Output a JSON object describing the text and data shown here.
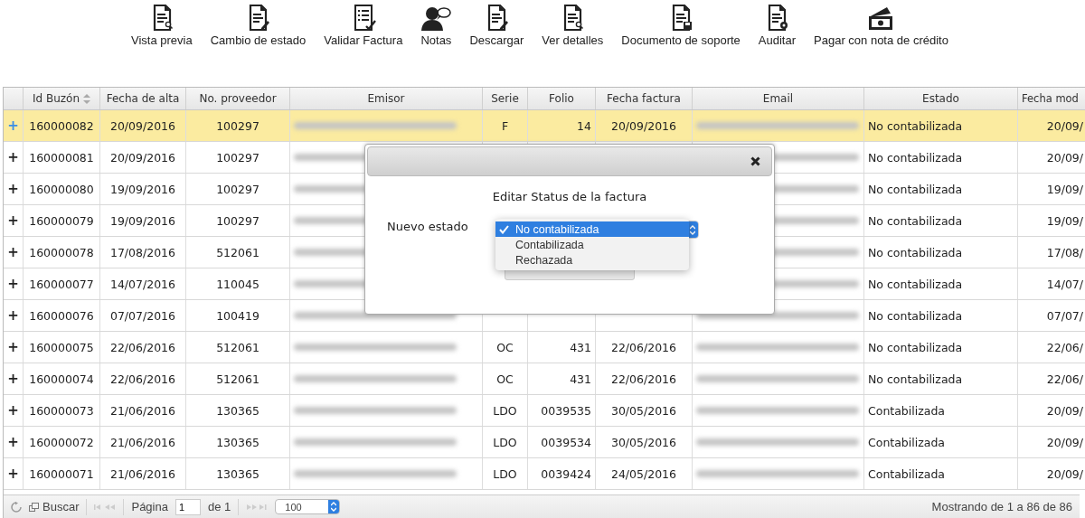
{
  "toolbar": [
    {
      "label": "Vista previa"
    },
    {
      "label": "Cambio de estado"
    },
    {
      "label": "Validar Factura"
    },
    {
      "label": "Notas"
    },
    {
      "label": "Descargar"
    },
    {
      "label": "Ver detalles"
    },
    {
      "label": "Documento de soporte"
    },
    {
      "label": "Auditar"
    },
    {
      "label": "Pagar con nota de crédito"
    }
  ],
  "table": {
    "columns": [
      "Id Buzón",
      "Fecha de alta",
      "No. proveedor",
      "Emisor",
      "Serie",
      "Folio",
      "Fecha factura",
      "Email",
      "Estado",
      "Fecha mod"
    ],
    "rows": [
      {
        "selected": true,
        "expand": "+",
        "cells": [
          "160000082",
          "20/09/2016",
          "100297",
          "",
          "F",
          "14",
          "20/09/2016",
          "",
          "No contabilizada",
          "20/09/"
        ]
      },
      {
        "selected": false,
        "expand": "+",
        "cells": [
          "160000081",
          "20/09/2016",
          "100297",
          "",
          "",
          "",
          "",
          "",
          "No contabilizada",
          "20/09/"
        ]
      },
      {
        "selected": false,
        "expand": "+",
        "cells": [
          "160000080",
          "19/09/2016",
          "100297",
          "",
          "",
          "",
          "",
          "",
          "No contabilizada",
          "19/09/"
        ]
      },
      {
        "selected": false,
        "expand": "+",
        "cells": [
          "160000079",
          "19/09/2016",
          "100297",
          "",
          "",
          "",
          "",
          "",
          "No contabilizada",
          "19/09/"
        ]
      },
      {
        "selected": false,
        "expand": "+",
        "cells": [
          "160000078",
          "17/08/2016",
          "512061",
          "",
          "",
          "",
          "",
          "",
          "No contabilizada",
          "17/08/"
        ]
      },
      {
        "selected": false,
        "expand": "+",
        "cells": [
          "160000077",
          "14/07/2016",
          "110045",
          "",
          "",
          "",
          "",
          "",
          "No contabilizada",
          "14/07/"
        ]
      },
      {
        "selected": false,
        "expand": "+",
        "cells": [
          "160000076",
          "07/07/2016",
          "100419",
          "",
          "",
          "",
          "",
          "",
          "No contabilizada",
          "07/07/"
        ]
      },
      {
        "selected": false,
        "expand": "+",
        "cells": [
          "160000075",
          "22/06/2016",
          "512061",
          "",
          "OC",
          "431",
          "22/06/2016",
          "",
          "No contabilizada",
          "22/06/"
        ]
      },
      {
        "selected": false,
        "expand": "+",
        "cells": [
          "160000074",
          "22/06/2016",
          "512061",
          "",
          "OC",
          "431",
          "22/06/2016",
          "",
          "No contabilizada",
          "22/06/"
        ]
      },
      {
        "selected": false,
        "expand": "+",
        "cells": [
          "160000073",
          "21/06/2016",
          "130365",
          "",
          "LDO",
          "0039535",
          "30/05/2016",
          "",
          "Contabilizada",
          "20/09/"
        ]
      },
      {
        "selected": false,
        "expand": "+",
        "cells": [
          "160000072",
          "21/06/2016",
          "130365",
          "",
          "LDO",
          "0039534",
          "30/05/2016",
          "",
          "Contabilizada",
          "20/09/"
        ]
      },
      {
        "selected": false,
        "expand": "+",
        "cells": [
          "160000071",
          "21/06/2016",
          "130365",
          "",
          "LDO",
          "0039424",
          "24/05/2016",
          "",
          "Contabilizada",
          "20/09/"
        ]
      }
    ]
  },
  "dialog": {
    "heading": "Editar Status de la factura",
    "label": "Nuevo estado",
    "options": [
      {
        "label": "No contabilizada",
        "selected": true
      },
      {
        "label": "Contabilizada",
        "selected": false
      },
      {
        "label": "Rechazada",
        "selected": false
      }
    ]
  },
  "pager": {
    "search": "Buscar",
    "page_label": "Página",
    "page": "1",
    "of": "de 1",
    "page_size": "100",
    "summary": "Mostrando de 1 a 86 de 86"
  }
}
